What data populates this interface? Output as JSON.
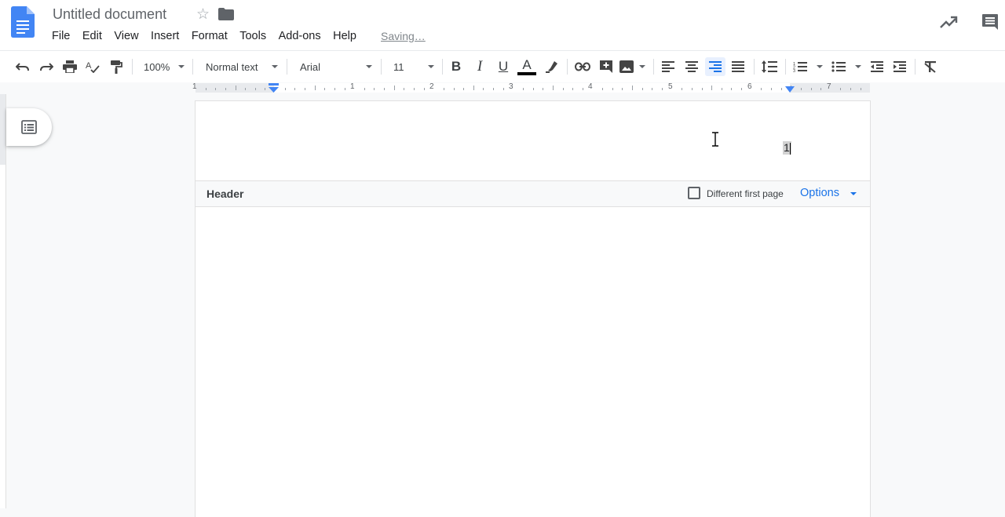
{
  "app": {
    "title": "Untitled document",
    "status": "Saving…",
    "icons": {
      "logo": "docs-logo-icon",
      "star": "star-icon",
      "folder": "folder-icon",
      "activity": "trending-up-icon",
      "comments": "comment-icon"
    }
  },
  "menu": [
    "File",
    "Edit",
    "View",
    "Insert",
    "Format",
    "Tools",
    "Add-ons",
    "Help"
  ],
  "toolbar": {
    "zoom": "100%",
    "style": "Normal text",
    "font": "Arial",
    "font_size": "11",
    "bold": "B",
    "italic": "I",
    "underline": "U",
    "text_color_letter": "A",
    "text_color": "#000000",
    "active_alignment": "right"
  },
  "ruler": {
    "numbers": [
      "1",
      "1",
      "1",
      "2",
      "3",
      "4",
      "5",
      "6",
      "7"
    ]
  },
  "page": {
    "page_number": "1",
    "header_label": "Header",
    "different_first_page_label": "Different first page",
    "different_first_page_checked": false,
    "options_label": "Options"
  },
  "colors": {
    "accent": "#1a73e8",
    "docs_blue": "#4285f4"
  }
}
